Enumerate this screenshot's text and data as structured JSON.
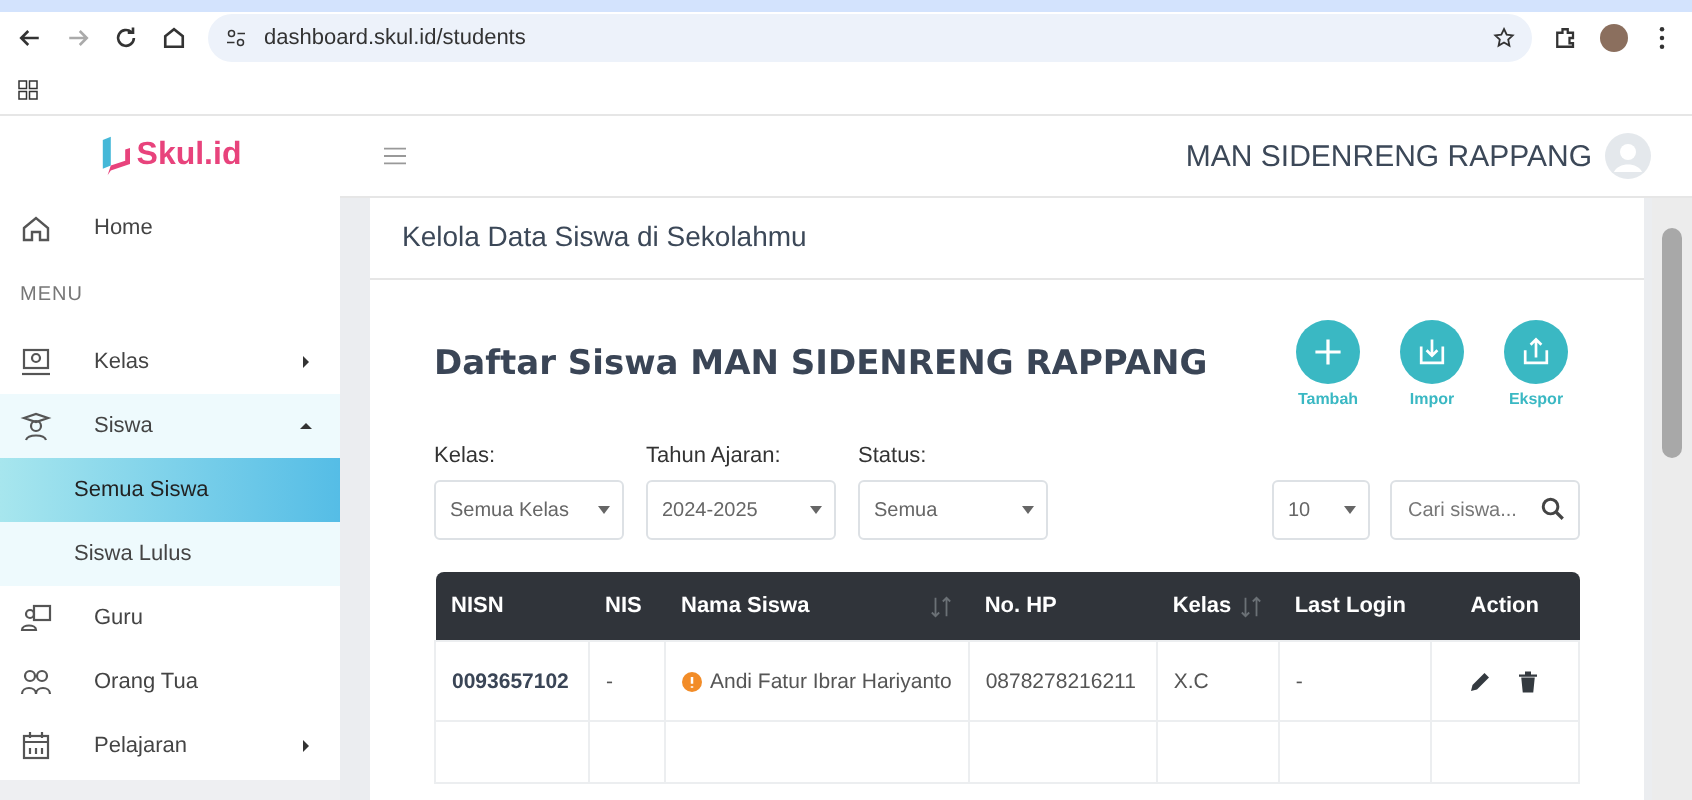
{
  "browser": {
    "url": "dashboard.skul.id/students"
  },
  "brand": {
    "logo": "Skul.id"
  },
  "header": {
    "school": "MAN SIDENRENG RAPPANG"
  },
  "sidebar": {
    "items": [
      {
        "label": "Home",
        "kind": "link",
        "selected": false
      },
      {
        "label": "MENU",
        "kind": "section"
      },
      {
        "label": "Kelas",
        "kind": "group",
        "expanded": false,
        "selected": false
      },
      {
        "label": "Siswa",
        "kind": "group",
        "expanded": true,
        "selected": false,
        "children": [
          {
            "label": "Semua Siswa",
            "selected": true
          },
          {
            "label": "Siswa Lulus",
            "selected": false
          }
        ]
      },
      {
        "label": "Guru",
        "kind": "link",
        "selected": false
      },
      {
        "label": "Orang Tua",
        "kind": "link",
        "selected": false
      },
      {
        "label": "Pelajaran",
        "kind": "group",
        "expanded": false,
        "selected": false
      }
    ]
  },
  "page_title": "Kelola Data Siswa di Sekolahmu",
  "heading": "Daftar Siswa MAN SIDENRENG RAPPANG",
  "actions": [
    {
      "label": "Tambah",
      "kind": "add"
    },
    {
      "label": "Impor",
      "kind": "import"
    },
    {
      "label": "Ekspor",
      "kind": "export"
    }
  ],
  "filters": [
    {
      "label": "Kelas:",
      "value": "Semua Kelas"
    },
    {
      "label": "Tahun Ajaran:",
      "value": "2024-2025"
    },
    {
      "label": "Status:",
      "value": "Semua"
    }
  ],
  "page_size": "10",
  "search": {
    "placeholder": "Cari siswa..."
  },
  "table": {
    "columns": [
      {
        "label": "NISN",
        "sortable": false
      },
      {
        "label": "NIS",
        "sortable": false
      },
      {
        "label": "Nama Siswa",
        "sortable": true
      },
      {
        "label": "No. HP",
        "sortable": false
      },
      {
        "label": "Kelas",
        "sortable": true
      },
      {
        "label": "Last Login",
        "sortable": false
      },
      {
        "label": "Action",
        "sortable": false
      }
    ],
    "rows": [
      {
        "nisn": "0093657102",
        "nis": "-",
        "name": "Andi Fatur Ibrar Hariyanto",
        "warning": true,
        "phone": "0878278216211",
        "kelas": "X.C",
        "last_login": "-"
      }
    ]
  }
}
